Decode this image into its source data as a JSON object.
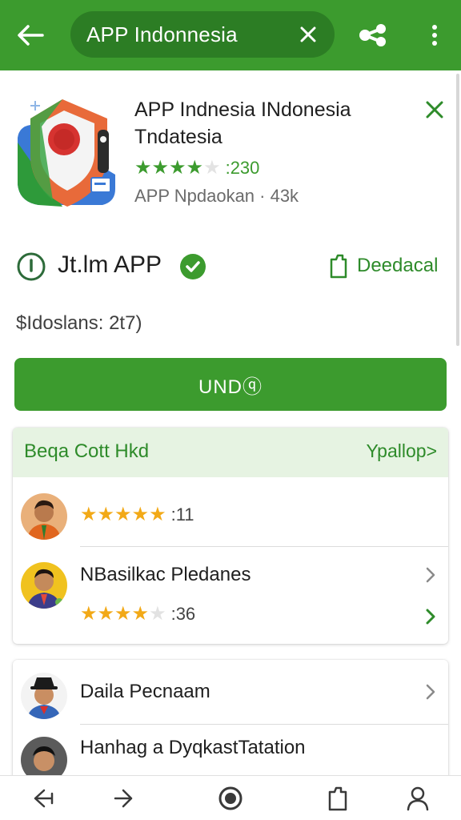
{
  "top_bar": {
    "search_value": "APP Indonnesia",
    "icons": {
      "back": "arrow-left-icon",
      "clear": "close-icon",
      "share": "share-icon",
      "more": "more-vert-icon"
    },
    "color": "#3c9b2e"
  },
  "app": {
    "title": "APP Indnesia INdonesia Tndatesia",
    "rating_stars": 4,
    "rating_count": ":230",
    "subtitle": "APP Npdaokan · 43k",
    "icon": "app-shield-icon",
    "dismiss_icon": "close-icon"
  },
  "developer": {
    "name": "Jt.lm APP",
    "verified_icon": "verified-check-icon",
    "action_label": "Deedacal",
    "action_icon": "bookmark-icon",
    "info_icon": "info-icon"
  },
  "downloads_text": "$Idoslans: 2t7)",
  "primary_button_label": "UNDⓠ",
  "section": {
    "title": "Beqa Cott Hkd",
    "link": "Ypallop>"
  },
  "reviews": [
    {
      "rating_stars": 5,
      "count": ":11"
    },
    {
      "name": "NBasilkac Pledanes",
      "rating_stars": 4,
      "count": ":36"
    }
  ],
  "list": [
    {
      "name": "Daila Pecnaam"
    },
    {
      "name": "Hanhag a DyqkastTatation"
    }
  ],
  "bottom_nav": [
    "back-nav-icon",
    "forward-icon",
    "home-record-icon",
    "tabs-icon",
    "profile-icon"
  ],
  "colors": {
    "brand": "#3c9b2e",
    "brand_dark": "#2c7d24",
    "star": "#f2a917",
    "section_bg": "#e6f3e2"
  }
}
